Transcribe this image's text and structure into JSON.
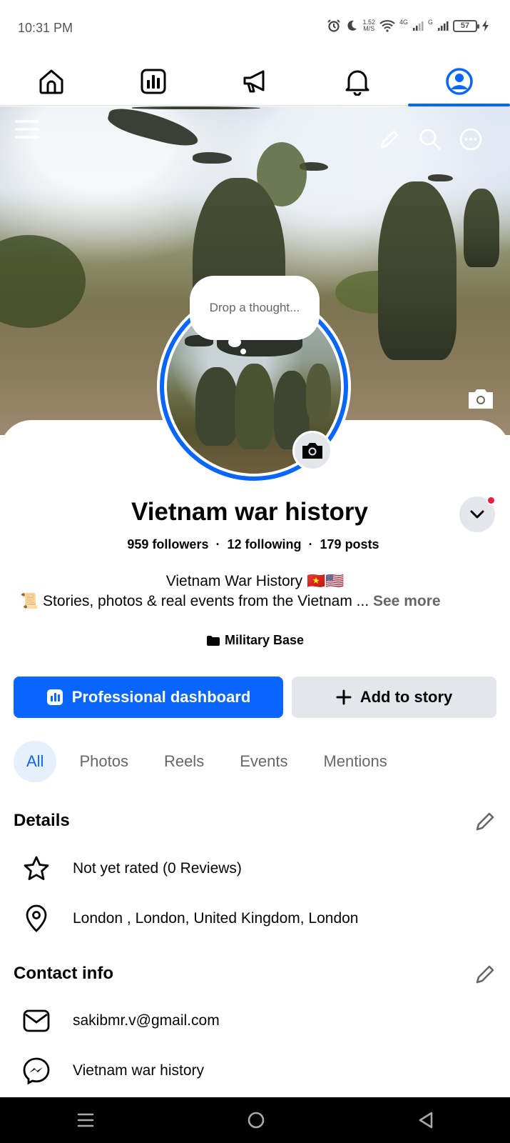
{
  "status_bar": {
    "time": "10:31 PM",
    "network_speed": "1.52",
    "network_speed_unit": "M/S",
    "network_type_1": "4G",
    "network_type_2": "G",
    "battery": "57"
  },
  "top_nav": {
    "tabs": [
      "home-icon",
      "dashboard-icon",
      "megaphone-icon",
      "bell-icon",
      "profile-icon"
    ],
    "active_tab": "profile-icon",
    "accent_color": "#0866ff"
  },
  "cover": {
    "thought_placeholder": "Drop a thought..."
  },
  "profile": {
    "name": "Vietnam war history",
    "followers": "959 followers",
    "following": "12 following",
    "posts": "179 posts",
    "separator": "·",
    "bio_line1": "Vietnam War History 🇻🇳🇺🇸",
    "bio_line2": "📜 Stories, photos & real events from the Vietnam ...",
    "see_more": "See more",
    "category": "Military Base"
  },
  "actions": {
    "primary_label": "Professional dashboard",
    "secondary_label": "Add to story"
  },
  "filters": {
    "items": [
      "All",
      "Photos",
      "Reels",
      "Events",
      "Mentions"
    ],
    "active": "All"
  },
  "details": {
    "title": "Details",
    "rating": "Not yet rated (0 Reviews)",
    "location": "London , London, United Kingdom, London"
  },
  "contact": {
    "title": "Contact info",
    "email": "sakibmr.v@gmail.com",
    "messenger": "Vietnam war history"
  }
}
